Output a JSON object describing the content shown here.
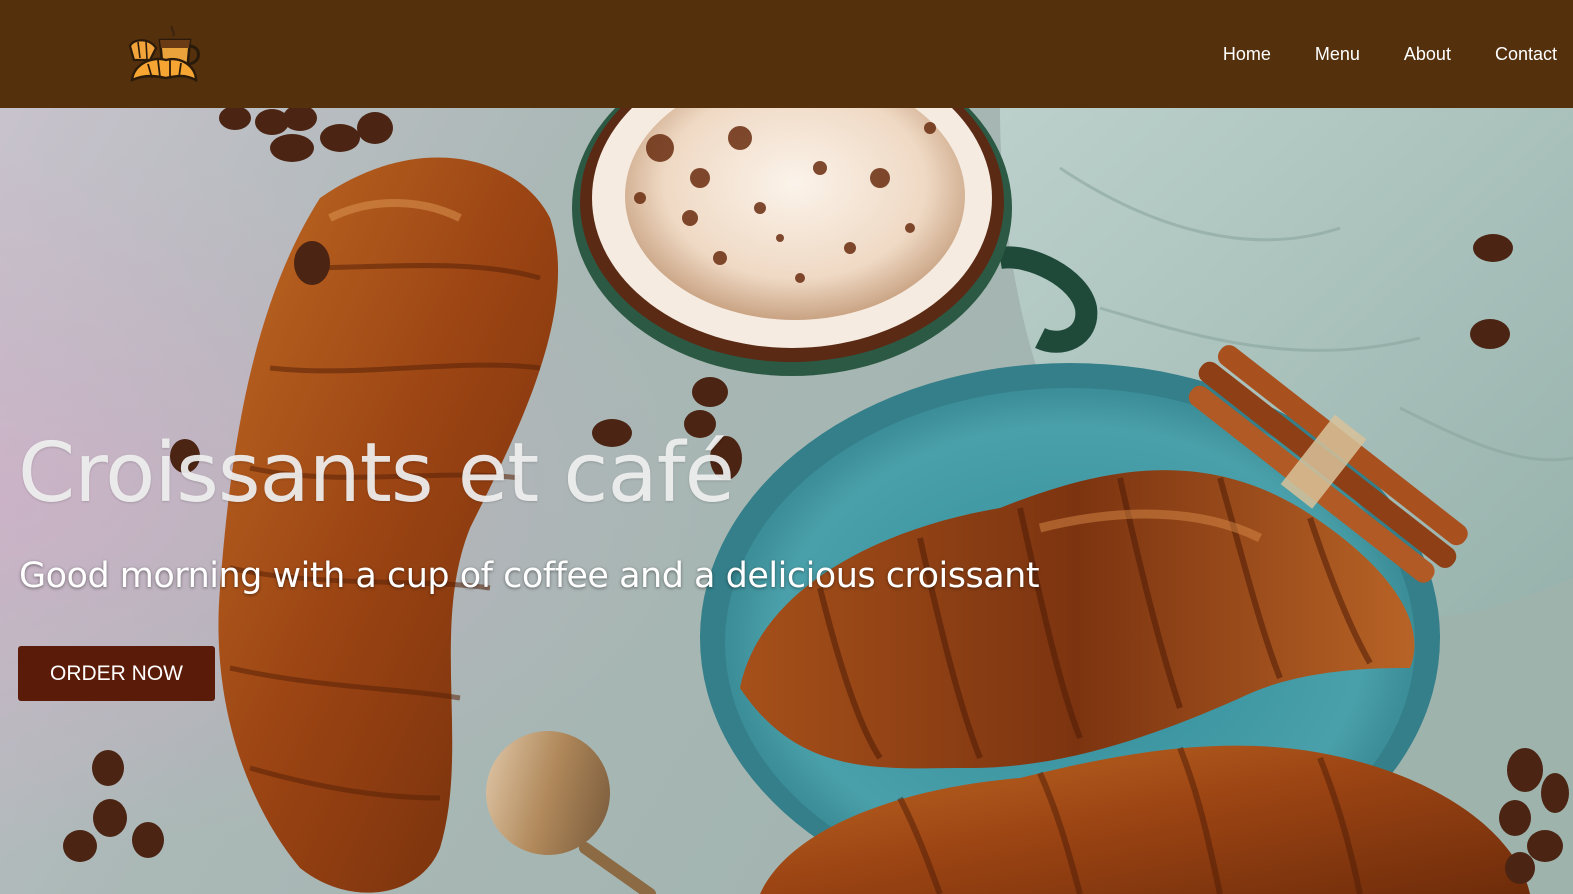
{
  "nav": {
    "logo_icon": "croissant-coffee-icon",
    "links": [
      "Home",
      "Menu",
      "About",
      "Contact"
    ]
  },
  "hero": {
    "title": "Croissants et café",
    "subtitle": "Good morning with a cup of coffee and a delicious croissant",
    "cta_label": "ORDER NOW",
    "background_image": "croissants-and-coffee-photo"
  },
  "colors": {
    "nav_bg": "#54300d",
    "button_bg": "#5a1c08",
    "text_light": "#ffffff"
  }
}
